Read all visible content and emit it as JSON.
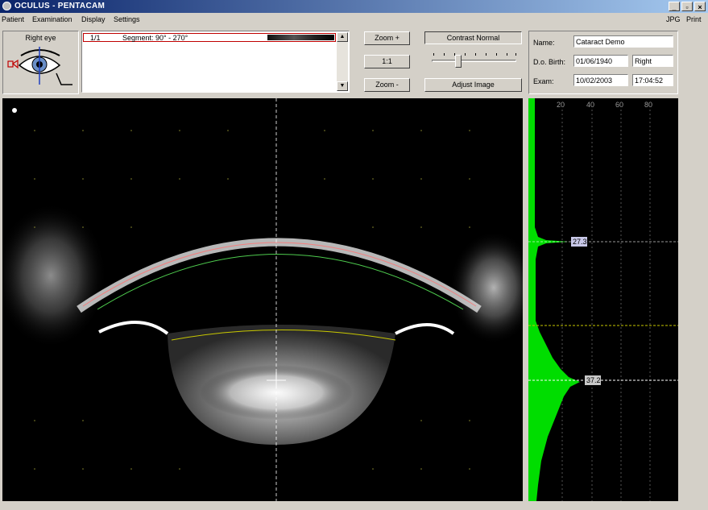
{
  "window": {
    "title": "OCULUS - PENTACAM"
  },
  "menu": {
    "items": [
      "Patient",
      "Examination",
      "Display",
      "Settings"
    ],
    "right_items": [
      "JPG",
      "Print"
    ]
  },
  "eye": {
    "label": "Right eye"
  },
  "segment": {
    "index": "1/1",
    "label": "Segment: 90° - 270°"
  },
  "zoom": {
    "zoom_in": "Zoom +",
    "reset": "1:1",
    "zoom_out": "Zoom -"
  },
  "image": {
    "contrast_label": "Contrast Normal",
    "adjust_label": "Adjust Image"
  },
  "patient": {
    "name_label": "Name:",
    "name": "Cataract Demo",
    "dob_label": "D.o. Birth:",
    "dob": "01/06/1940",
    "eye_side": "Right",
    "exam_label": "Exam:",
    "exam_date": "10/02/2003",
    "exam_time": "17:04:52"
  },
  "densitogram": {
    "ticks": [
      "20",
      "40",
      "60",
      "80"
    ],
    "peak_1": "27.3",
    "peak_2": "37.2",
    "fill_color": "#00dd00"
  },
  "colors": {
    "titlebar": "#0a246a",
    "segment_border": "#c00000"
  }
}
